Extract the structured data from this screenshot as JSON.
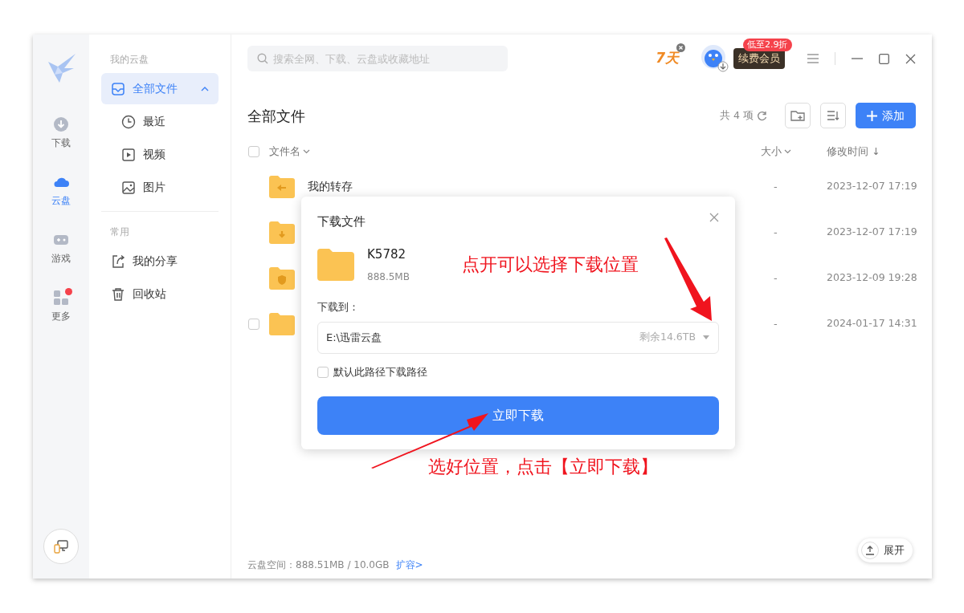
{
  "rail": [
    {
      "label": "下载",
      "selected": false,
      "badge": false
    },
    {
      "label": "云盘",
      "selected": true,
      "badge": false
    },
    {
      "label": "游戏",
      "selected": false,
      "badge": false
    },
    {
      "label": "更多",
      "selected": false,
      "badge": true
    }
  ],
  "sidebar": {
    "sections": [
      {
        "title": "我的云盘",
        "items": [
          {
            "label": "全部文件",
            "selected": true,
            "expanded": true,
            "children": [
              {
                "label": "最近",
                "selected": false
              },
              {
                "label": "视频",
                "selected": false
              },
              {
                "label": "图片",
                "selected": false
              }
            ]
          }
        ]
      },
      {
        "title": "常用",
        "items": [
          {
            "label": "我的分享",
            "selected": false
          },
          {
            "label": "回收站",
            "selected": false
          }
        ]
      }
    ]
  },
  "search": {
    "placeholder": "搜索全网、下载、云盘或收藏地址"
  },
  "header": {
    "trial": "7天",
    "promo_badge": "低至2.9折",
    "vip_button": "续费会员"
  },
  "content": {
    "title": "全部文件",
    "count": "共 4 项",
    "add_button": "添加",
    "select_all": {
      "checked": false
    },
    "columns": [
      {
        "label": "文件名"
      },
      {
        "label": "大小"
      },
      {
        "label": "修改时间 ↓"
      }
    ],
    "rows": [
      {
        "kind": "transfer",
        "name": "我的转存",
        "size": "-",
        "modified": "2023-12-07 17:19",
        "hovered": false,
        "checked": false
      },
      {
        "kind": "download",
        "size": "-",
        "modified": "2023-12-07 17:19",
        "hovered": false,
        "checked": false
      },
      {
        "kind": "app",
        "size": "-",
        "modified": "2023-12-09 19:28",
        "hovered": false,
        "checked": false
      },
      {
        "kind": "plain",
        "size": "-",
        "modified": "2024-01-17 14:31",
        "hovered": true,
        "checked": false
      }
    ],
    "storage": "云盘空间：888.51MB / 10.0GB",
    "expand_link": "扩容>",
    "expand_button": "展开"
  },
  "dialog": {
    "title": "下载文件",
    "file_name": "K5782",
    "file_size": "888.5MB",
    "target_label": "下载到：",
    "path": "E:\\迅雷云盘",
    "free_space": "剩余14.6TB",
    "default_checkbox": {
      "label": "默认此路径下载路径",
      "checked": false
    },
    "download_button": "立即下载"
  },
  "annotations": [
    {
      "text": "点开可以选择下载位置"
    },
    {
      "text": "选好位置，点击【立即下载】"
    }
  ]
}
